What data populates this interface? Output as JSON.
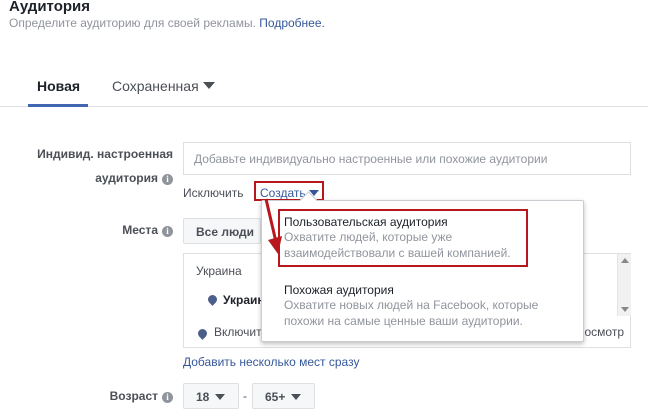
{
  "header": {
    "title": "Аудитория",
    "subtitle": "Определите аудиторию для своей рекламы.",
    "learn_more": "Подробнее."
  },
  "tabs": [
    {
      "label": "Новая",
      "active": true
    },
    {
      "label": "Сохраненная",
      "active": false
    }
  ],
  "custom_audience": {
    "label_line1": "Индивид. настроенная",
    "label_line2": "аудитория",
    "placeholder": "Добавьте индивидуально настроенные или похожие аудитории",
    "exclude_label": "Исключить",
    "create_label": "Создать"
  },
  "places": {
    "label": "Места",
    "everyone_button": "Все люди",
    "country_header": "Украина",
    "selected_item": "Украина",
    "include_label": "Включить",
    "view_label": "осмотр",
    "add_many_link": "Добавить несколько мест сразу"
  },
  "age": {
    "label": "Возраст",
    "min": "18",
    "max": "65+",
    "separator": "-"
  },
  "create_menu": {
    "items": [
      {
        "title": "Пользовательская аудитория",
        "description_line1": "Охватите людей, которые уже",
        "description_line2": "взаимодействовали с вашей компанией."
      },
      {
        "title": "Похожая аудитория",
        "description_line1": "Охватите новых людей на Facebook, которые",
        "description_line2": "похожи на самые ценные ваши аудитории."
      }
    ]
  },
  "colors": {
    "link": "#365899",
    "highlight": "#b8181d",
    "tab_active": "#4267b2"
  }
}
